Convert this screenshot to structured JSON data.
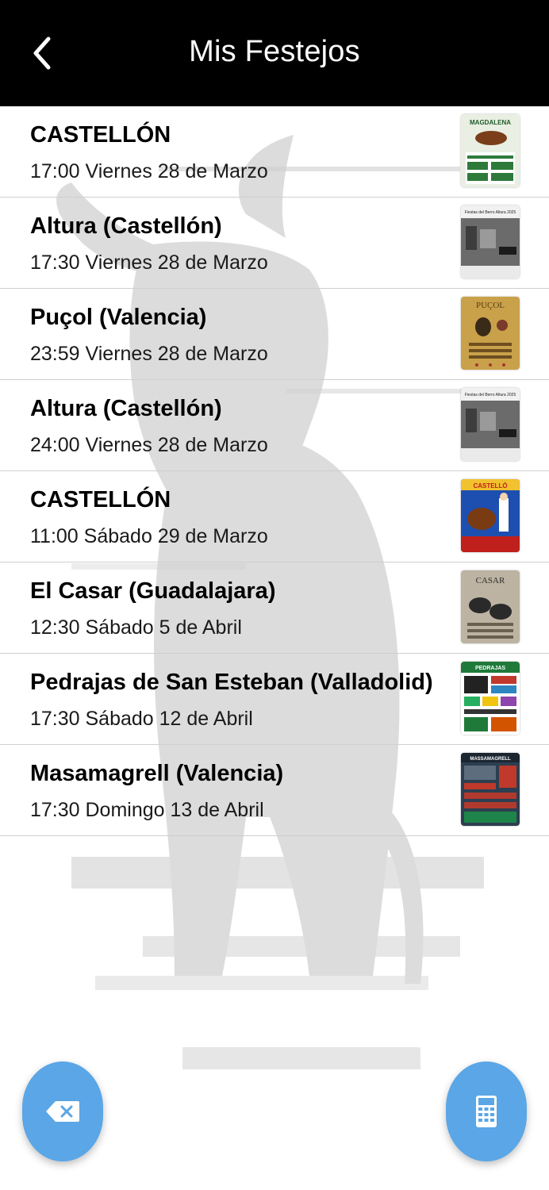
{
  "header": {
    "title": "Mis Festejos",
    "back_icon": "chevron-left-icon"
  },
  "events": [
    {
      "town": "CASTELLÓN",
      "date": "17:00 Viernes 28 de Marzo",
      "poster_text": "MAGDALENA"
    },
    {
      "town": "Altura (Castellón)",
      "date": "17:30 Viernes 28 de Marzo",
      "poster_text": "Fiestas del Berro Altura 2025"
    },
    {
      "town": "Puçol (Valencia)",
      "date": "23:59 Viernes 28 de Marzo",
      "poster_text": "PUÇOL"
    },
    {
      "town": "Altura (Castellón)",
      "date": "24:00 Viernes 28 de Marzo",
      "poster_text": "Fiestas del Berro Altura 2025"
    },
    {
      "town": "CASTELLÓN",
      "date": "11:00 Sábado 29 de Marzo",
      "poster_text": "CASTELLÓ"
    },
    {
      "town": "El Casar (Guadalajara)",
      "date": "12:30 Sábado 5 de Abril",
      "poster_text": "CASAR"
    },
    {
      "town": "Pedrajas de San Esteban (Valladolid)",
      "date": "17:30 Sábado 12 de Abril",
      "poster_text": "PEDRAJAS"
    },
    {
      "town": "Masamagrell (Valencia)",
      "date": "17:30 Domingo 13 de Abril",
      "poster_text": "MASSAMAGRELL"
    }
  ],
  "buttons": {
    "left_icon": "backspace-clear-icon",
    "right_icon": "calculator-icon"
  },
  "colors": {
    "header_bg": "#000000",
    "fab": "#5aa6e6",
    "watermark": "#d9d9d9"
  }
}
